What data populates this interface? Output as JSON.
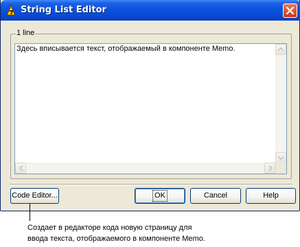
{
  "window": {
    "title": "String List Editor"
  },
  "editor": {
    "line_count_label": "1 line",
    "memo_text": "Здесь вписывается текст, отображаемый в компоненте Memo."
  },
  "buttons": {
    "code_editor": "Code Editor...",
    "ok": "OK",
    "cancel": "Cancel",
    "help": "Help"
  },
  "caption": {
    "line1": "Создает в редакторе кода новую страницу для",
    "line2": "ввода текста, отображаемого в компоненте Memo."
  },
  "colors": {
    "titlebar": "#0a54e0",
    "dialog_bg": "#ece9d8",
    "button_border": "#003c74",
    "close_button": "#c8381c"
  },
  "icons": {
    "app": "delphi-helmet-icon",
    "close": "close-icon"
  }
}
